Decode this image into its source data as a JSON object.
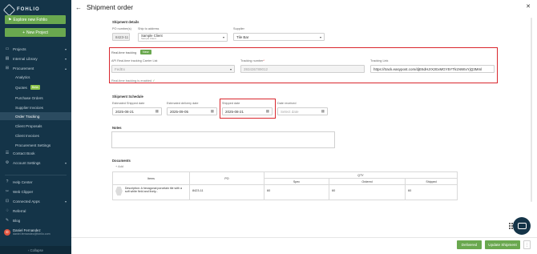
{
  "app": {
    "name": "FOHLIO"
  },
  "sidebar": {
    "explore_label": "Explore new Fohlio",
    "new_project_label": "New Project",
    "nav": {
      "projects": "Projects",
      "internal_library": "Internal Library",
      "procurement": "Procurement",
      "analytics": "Analytics",
      "quotes": "Quotes",
      "quotes_badge": "Beta",
      "purchase_orders": "Purchase Orders",
      "supplier_invoices": "Supplier Invoices",
      "order_tracking": "Order Tracking",
      "client_proposals": "Client Proposals",
      "client_invoices": "Client Invoices",
      "procurement_settings": "Procurement Settings",
      "contact_book": "Contact Book",
      "account_settings": "Account Settings",
      "help_center": "Help Center",
      "web_clipper": "Web Clipper",
      "connected_apps": "Connected Apps",
      "referral": "Referral",
      "blog": "Blog"
    },
    "user": {
      "initial": "D",
      "name": "Daniel Fernandez",
      "email": "daniel.fernandez@fohlio.com"
    },
    "collapse_label": "Collapse"
  },
  "page": {
    "title": "Shipment order"
  },
  "shipment_details": {
    "heading": "Shipment details",
    "po_label": "PO number(s)",
    "po_value": "8423-11",
    "ship_to_label": "Ship to address",
    "ship_to_value": "Sample Client",
    "ship_to_sub": "Sample Client",
    "supplier_label": "Supplier",
    "supplier_value": "Tile Bar"
  },
  "realtime": {
    "title": "Real-time tracking",
    "badge": "New",
    "carrier_label": "API Real-time tracking Carrier List",
    "carrier_value": "FedEx",
    "tracking_label": "Tracking number",
    "tracking_required": "*",
    "tracking_value": "393436789012",
    "link_label": "Tracking Link",
    "link_value": "https://track.easypost.com/djE6dHJrXzExMGY5YTk1NWIxYjQ3Mml",
    "enabled_text": "Real-time tracking is enabled",
    "enabled_icon": "check-icon"
  },
  "schedule": {
    "heading": "Shipment Schedule",
    "est_shipped_label": "Estimated Shipped date",
    "est_shipped_value": "2025-08-21",
    "est_delivery_label": "Estimated delivery date",
    "est_delivery_value": "2025-09-05",
    "shipped_label": "Shipped date",
    "shipped_value": "2025-08-21",
    "received_label": "Date received",
    "received_placeholder": "Select date"
  },
  "notes": {
    "heading": "Notes"
  },
  "documents": {
    "heading": "Documents",
    "add_label": "+ Add"
  },
  "items_table": {
    "headers": {
      "items": "Items",
      "po": "PO",
      "qty": "QTY",
      "spec": "Spec",
      "ordered": "Ordered",
      "shipped": "Shipped"
    },
    "rows": [
      {
        "description": "Description: A hexagonal porcelain tile with a soft white field and lively...",
        "po": "8423-11",
        "spec": "60",
        "ordered": "60",
        "shipped": "60"
      }
    ]
  },
  "footer": {
    "delivered_label": "Delivered",
    "update_label": "Update Shipment",
    "more_label": "⋮"
  },
  "colors": {
    "sidebar": "#143448",
    "accent_green": "#6aa84f",
    "highlight_red": "#d9272e"
  }
}
